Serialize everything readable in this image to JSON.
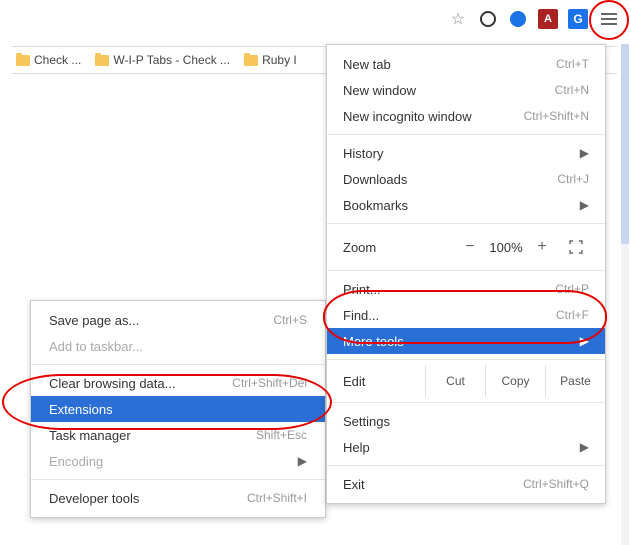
{
  "toolbar": {
    "star_title": "Bookmark this page",
    "icon1": "opera-style",
    "icon2": "circle",
    "adobe": "A",
    "gtranslate": "G"
  },
  "bookmarks": [
    {
      "label": "Check ..."
    },
    {
      "label": "W-I-P Tabs - Check ..."
    },
    {
      "label": "Ruby I"
    }
  ],
  "main_menu": {
    "new_tab": {
      "label": "New tab",
      "shortcut": "Ctrl+T"
    },
    "new_window": {
      "label": "New window",
      "shortcut": "Ctrl+N"
    },
    "incognito": {
      "label": "New incognito window",
      "shortcut": "Ctrl+Shift+N"
    },
    "history": {
      "label": "History"
    },
    "downloads": {
      "label": "Downloads",
      "shortcut": "Ctrl+J"
    },
    "bookmarks": {
      "label": "Bookmarks"
    },
    "zoom": {
      "label": "Zoom",
      "minus": "−",
      "value": "100%",
      "plus": "+"
    },
    "print": {
      "label": "Print...",
      "shortcut": "Ctrl+P"
    },
    "find": {
      "label": "Find...",
      "shortcut": "Ctrl+F"
    },
    "more_tools": {
      "label": "More tools"
    },
    "edit": {
      "label": "Edit",
      "cut": "Cut",
      "copy": "Copy",
      "paste": "Paste"
    },
    "settings": {
      "label": "Settings"
    },
    "help": {
      "label": "Help"
    },
    "exit": {
      "label": "Exit",
      "shortcut": "Ctrl+Shift+Q"
    }
  },
  "sub_menu": {
    "save_page": {
      "label": "Save page as...",
      "shortcut": "Ctrl+S"
    },
    "add_taskbar": {
      "label": "Add to taskbar..."
    },
    "clear_data": {
      "label": "Clear browsing data...",
      "shortcut": "Ctrl+Shift+Del"
    },
    "extensions": {
      "label": "Extensions"
    },
    "task_mgr": {
      "label": "Task manager",
      "shortcut": "Shift+Esc"
    },
    "encoding": {
      "label": "Encoding"
    },
    "dev_tools": {
      "label": "Developer tools",
      "shortcut": "Ctrl+Shift+I"
    }
  }
}
